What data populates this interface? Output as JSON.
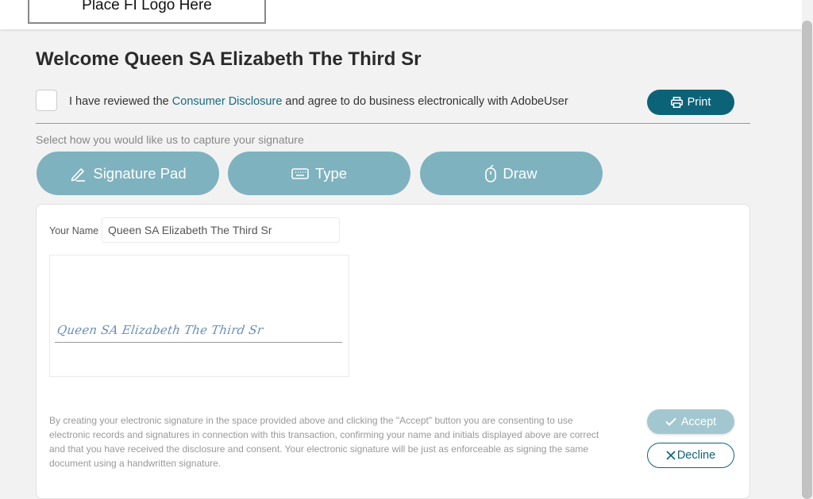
{
  "header": {
    "logo_text": "Place FI Logo Here"
  },
  "welcome": {
    "title": "Welcome Queen SA Elizabeth The Third Sr"
  },
  "consent": {
    "prefix": "I have reviewed the ",
    "link_text": "Consumer Disclosure",
    "suffix": " and agree to do business electronically with AdobeUser",
    "checked": false
  },
  "print_button": {
    "label": "Print",
    "icon": "printer-icon"
  },
  "capture": {
    "prompt": "Select how you would like us to capture your signature",
    "methods": [
      {
        "label": "Signature Pad",
        "icon": "pen-icon"
      },
      {
        "label": "Type",
        "icon": "keyboard-icon"
      },
      {
        "label": "Draw",
        "icon": "mouse-icon"
      }
    ]
  },
  "form": {
    "name_label": "Your Name",
    "name_value": "Queen SA Elizabeth The Third Sr",
    "signature_preview": "Queen SA Elizabeth The Third Sr",
    "legal_text": "By creating your electronic signature in the space provided above and clicking the \"Accept\" button you are consenting to use electronic records and signatures in connection with this transaction, confirming your name and initials displayed above are correct and that you have received the disclosure and consent. Your electronic signature will be just as enforceable as signing the same document using a handwritten signature."
  },
  "actions": {
    "accept_label": "Accept",
    "decline_label": "Decline"
  },
  "colors": {
    "primary": "#0c6378",
    "method_button": "#7fb2bf",
    "accept_disabled": "#a3c7d0",
    "link": "#1a6a80"
  }
}
